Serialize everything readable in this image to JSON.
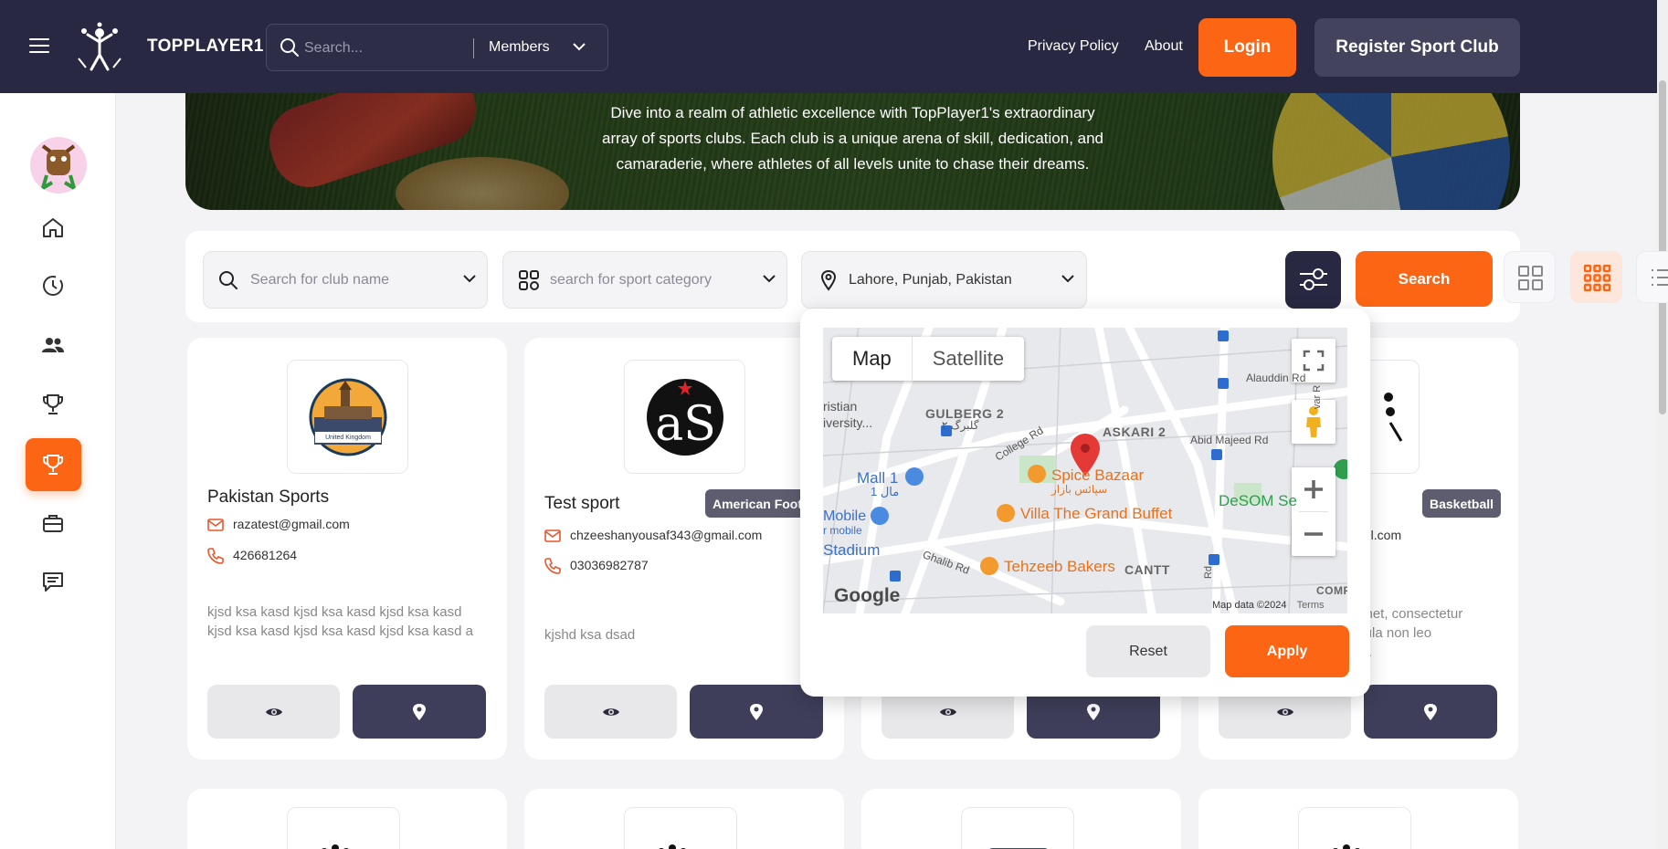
{
  "header": {
    "brand": "TOPPLAYER1",
    "search_placeholder": "Search...",
    "search_scope": "Members",
    "nav": [
      "Privacy Policy",
      "About"
    ],
    "login_label": "Login",
    "register_label": "Register Sport Club"
  },
  "sidebar": {
    "items": [
      "home-icon",
      "history-icon",
      "users-icon",
      "trophy-icon",
      "trophy-icon-active",
      "briefcase-icon",
      "chat-icon"
    ],
    "active_index": 4
  },
  "hero": {
    "lines": [
      "Dive into a realm of athletic excellence with TopPlayer1's extraordinary",
      "array of sports clubs. Each club is a unique arena of skill, dedication, and",
      "camaraderie, where athletes of all levels unite to chase their dreams."
    ]
  },
  "filters": {
    "club_placeholder": "Search for club name",
    "category_placeholder": "search for sport category",
    "location_value": "Lahore, Punjab, Pakistan",
    "search_label": "Search"
  },
  "cards": [
    {
      "title": "Pakistan Sports",
      "logo_text": "United Kingdom",
      "badge": "",
      "email": "razatest@gmail.com",
      "phone": "426681264",
      "description": "kjsd ksa kasd kjsd ksa kasd kjsd ksa kasd kjsd ksa kasd kjsd ksa kasd kjsd ksa kasd a"
    },
    {
      "title": "Test sport",
      "logo_text": "aS",
      "badge": "American Footb",
      "email": "chzeeshanyousaf343@gmail.com",
      "phone": "03036982787",
      "description": "kjshd ksa dsad"
    },
    {
      "title": "",
      "badge": "Basketball",
      "email": "nail.com",
      "desc_lines": [
        "amet, consectetur",
        "igula non leo",
        "nc."
      ]
    }
  ],
  "map": {
    "type_map": "Map",
    "type_satellite": "Satellite",
    "labels": [
      "GULBERG 2",
      "گلبرگ ۲",
      "ASKARI 2",
      "Abid Majeed Rd",
      "Alauddin Rd",
      "College Rd",
      "Mall 1",
      "مال 1",
      "Mobile",
      "r mobile",
      "Stadium",
      "Ghalib Rd",
      "CANTT",
      "COMP",
      "ristian",
      "iversity...",
      "DeSOM Se",
      "var R",
      "Rd"
    ],
    "pois": [
      "Spice Bazaar",
      "سپائس بازار",
      "Villa The Grand Buffet",
      "Tehzeeb Bakers"
    ],
    "google": "Google",
    "map_data": "Map data ©2024",
    "terms": "Terms",
    "reset_label": "Reset",
    "apply_label": "Apply"
  },
  "colors": {
    "navy": "#282842",
    "orange": "#fb6514"
  }
}
